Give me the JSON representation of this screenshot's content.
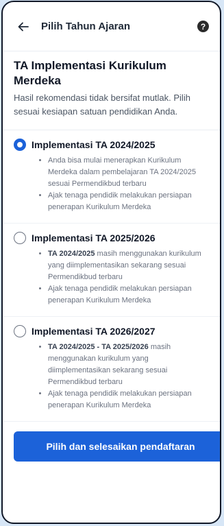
{
  "header": {
    "title": "Pilih Tahun Ajaran",
    "back_icon": "arrow-left-icon",
    "help_icon": "question-circle-icon",
    "help_symbol": "?"
  },
  "intro": {
    "heading": "TA Implementasi Kurikulum Merdeka",
    "description": "Hasil rekomendasi tidak bersifat mutlak. Pilih sesuai kesiapan satuan pendidikan Anda."
  },
  "options": [
    {
      "title": "Implementasi TA 2024/2025",
      "selected": true,
      "points": [
        {
          "bold": "",
          "text": "Anda bisa mulai menerapkan Kurikulum Merdeka dalam pembelajaran TA 2024/2025 sesuai Permendikbud terbaru"
        },
        {
          "bold": "",
          "text": "Ajak tenaga pendidik melakukan persiapan penerapan Kurikulum Merdeka"
        }
      ]
    },
    {
      "title": "Implementasi TA 2025/2026",
      "selected": false,
      "points": [
        {
          "bold": "TA 2024/2025",
          "text": " masih menggunakan kurikulum yang diimplementasikan sekarang sesuai Permendikbud terbaru"
        },
        {
          "bold": "",
          "text": "Ajak tenaga pendidik melakukan persiapan penerapan Kurikulum Merdeka"
        }
      ]
    },
    {
      "title": "Implementasi TA 2026/2027",
      "selected": false,
      "points": [
        {
          "bold": "TA 2024/2025 - TA 2025/2026",
          "text": " masih menggunakan kurikulum yang diimplementasikan sekarang sesuai Permendikbud terbaru"
        },
        {
          "bold": "",
          "text": "Ajak tenaga pendidik melakukan persiapan penerapan Kurikulum Merdeka"
        }
      ]
    }
  ],
  "cta_label": "Pilih dan selesaikan pendaftaran",
  "colors": {
    "accent": "#1c62d9",
    "background": "#d7e6f6"
  }
}
